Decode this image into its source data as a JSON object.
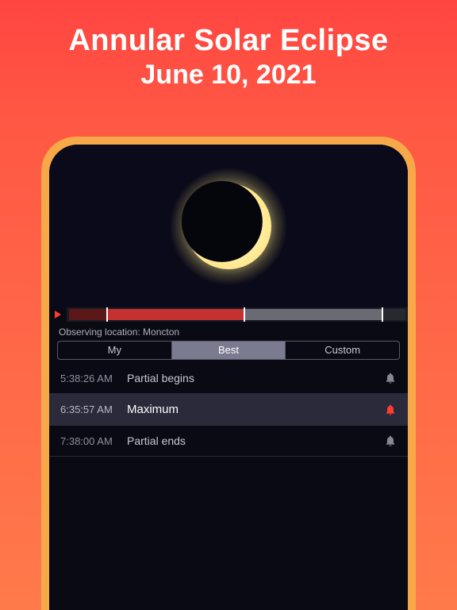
{
  "header": {
    "title": "Annular Solar Eclipse",
    "subtitle": "June 10, 2021"
  },
  "location": {
    "label": "Observing location: Moncton"
  },
  "tabs": {
    "my": "My",
    "best": "Best",
    "custom": "Custom",
    "active": "best"
  },
  "events": [
    {
      "time": "5:38:26 AM",
      "label": "Partial begins",
      "highlighted": false,
      "alarmActive": false
    },
    {
      "time": "6:35:57 AM",
      "label": "Maximum",
      "highlighted": true,
      "alarmActive": true
    },
    {
      "time": "7:38:00 AM",
      "label": "Partial ends",
      "highlighted": false,
      "alarmActive": false
    }
  ],
  "icons": {
    "play": "play-icon",
    "alarm": "alarm-icon"
  }
}
